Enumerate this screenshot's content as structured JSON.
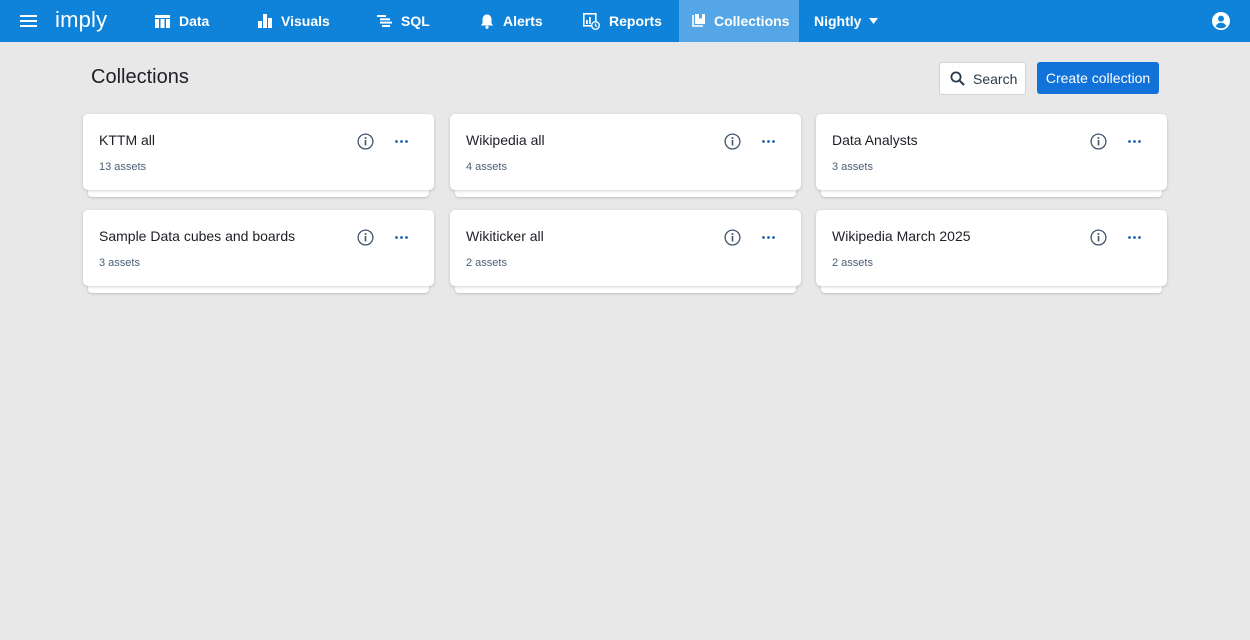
{
  "app": {
    "logo": "imply",
    "menu_icon": "hamburger-menu-icon",
    "user_icon": "user-account-icon"
  },
  "nav": {
    "items": [
      {
        "label": "Data",
        "icon": "table-icon"
      },
      {
        "label": "Visuals",
        "icon": "bar-chart-icon"
      },
      {
        "label": "SQL",
        "icon": "sql-lines-icon"
      },
      {
        "label": "Alerts",
        "icon": "bell-icon"
      },
      {
        "label": "Reports",
        "icon": "report-icon"
      },
      {
        "label": "Collections",
        "icon": "collections-icon",
        "active": true
      },
      {
        "label": "Nightly",
        "icon": "caret-down-icon"
      }
    ]
  },
  "header": {
    "title": "Collections",
    "search_label": "Search",
    "create_label": "Create collection"
  },
  "collections": [
    {
      "name": "KTTM all",
      "count": "13 assets"
    },
    {
      "name": "Wikipedia all",
      "count": "4 assets"
    },
    {
      "name": "Data Analysts",
      "count": "3 assets"
    },
    {
      "name": "Sample Data cubes and boards",
      "count": "3 assets"
    },
    {
      "name": "Wikiticker all",
      "count": "2 assets"
    },
    {
      "name": "Wikipedia March 2025",
      "count": "2 assets"
    }
  ],
  "colors": {
    "topbar": "#0f83d9",
    "active_tab": "#55a6e6",
    "primary_button": "#1172d9",
    "background": "#e8e8e8"
  }
}
